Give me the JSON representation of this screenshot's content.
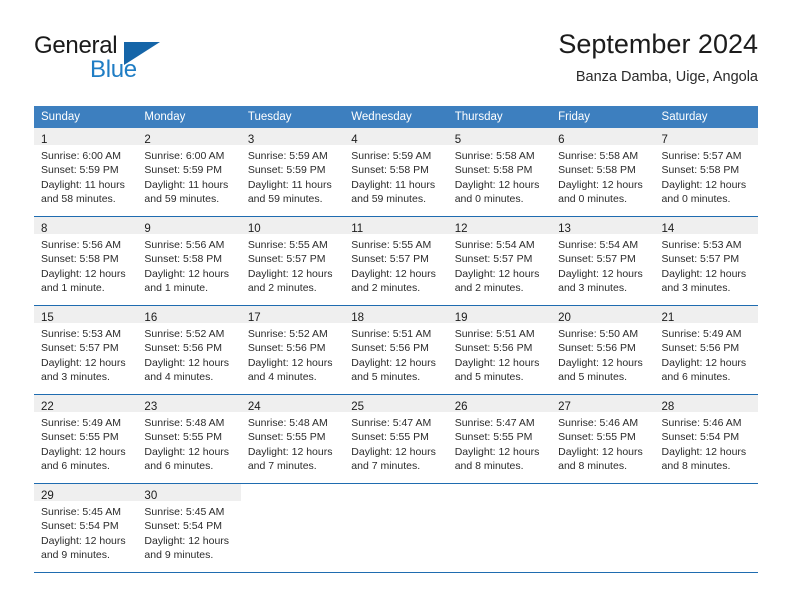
{
  "brand": {
    "name_part1": "General",
    "name_part2": "Blue",
    "triangle_icon": "logo-triangle"
  },
  "header": {
    "month_title": "September 2024",
    "location": "Banza Damba, Uige, Angola"
  },
  "weekday_headers": [
    "Sunday",
    "Monday",
    "Tuesday",
    "Wednesday",
    "Thursday",
    "Friday",
    "Saturday"
  ],
  "colors": {
    "header_blue": "#3d7fbf",
    "row_divider_blue": "#1f6cb0",
    "daynum_band": "#efefef",
    "brand_blue": "#1f7dc4",
    "triangle_blue": "#1565a8"
  },
  "weeks": [
    [
      {
        "day": "1",
        "sunrise": "Sunrise: 6:00 AM",
        "sunset": "Sunset: 5:59 PM",
        "daylight_line1": "Daylight: 11 hours",
        "daylight_line2": "and 58 minutes."
      },
      {
        "day": "2",
        "sunrise": "Sunrise: 6:00 AM",
        "sunset": "Sunset: 5:59 PM",
        "daylight_line1": "Daylight: 11 hours",
        "daylight_line2": "and 59 minutes."
      },
      {
        "day": "3",
        "sunrise": "Sunrise: 5:59 AM",
        "sunset": "Sunset: 5:59 PM",
        "daylight_line1": "Daylight: 11 hours",
        "daylight_line2": "and 59 minutes."
      },
      {
        "day": "4",
        "sunrise": "Sunrise: 5:59 AM",
        "sunset": "Sunset: 5:58 PM",
        "daylight_line1": "Daylight: 11 hours",
        "daylight_line2": "and 59 minutes."
      },
      {
        "day": "5",
        "sunrise": "Sunrise: 5:58 AM",
        "sunset": "Sunset: 5:58 PM",
        "daylight_line1": "Daylight: 12 hours",
        "daylight_line2": "and 0 minutes."
      },
      {
        "day": "6",
        "sunrise": "Sunrise: 5:58 AM",
        "sunset": "Sunset: 5:58 PM",
        "daylight_line1": "Daylight: 12 hours",
        "daylight_line2": "and 0 minutes."
      },
      {
        "day": "7",
        "sunrise": "Sunrise: 5:57 AM",
        "sunset": "Sunset: 5:58 PM",
        "daylight_line1": "Daylight: 12 hours",
        "daylight_line2": "and 0 minutes."
      }
    ],
    [
      {
        "day": "8",
        "sunrise": "Sunrise: 5:56 AM",
        "sunset": "Sunset: 5:58 PM",
        "daylight_line1": "Daylight: 12 hours",
        "daylight_line2": "and 1 minute."
      },
      {
        "day": "9",
        "sunrise": "Sunrise: 5:56 AM",
        "sunset": "Sunset: 5:58 PM",
        "daylight_line1": "Daylight: 12 hours",
        "daylight_line2": "and 1 minute."
      },
      {
        "day": "10",
        "sunrise": "Sunrise: 5:55 AM",
        "sunset": "Sunset: 5:57 PM",
        "daylight_line1": "Daylight: 12 hours",
        "daylight_line2": "and 2 minutes."
      },
      {
        "day": "11",
        "sunrise": "Sunrise: 5:55 AM",
        "sunset": "Sunset: 5:57 PM",
        "daylight_line1": "Daylight: 12 hours",
        "daylight_line2": "and 2 minutes."
      },
      {
        "day": "12",
        "sunrise": "Sunrise: 5:54 AM",
        "sunset": "Sunset: 5:57 PM",
        "daylight_line1": "Daylight: 12 hours",
        "daylight_line2": "and 2 minutes."
      },
      {
        "day": "13",
        "sunrise": "Sunrise: 5:54 AM",
        "sunset": "Sunset: 5:57 PM",
        "daylight_line1": "Daylight: 12 hours",
        "daylight_line2": "and 3 minutes."
      },
      {
        "day": "14",
        "sunrise": "Sunrise: 5:53 AM",
        "sunset": "Sunset: 5:57 PM",
        "daylight_line1": "Daylight: 12 hours",
        "daylight_line2": "and 3 minutes."
      }
    ],
    [
      {
        "day": "15",
        "sunrise": "Sunrise: 5:53 AM",
        "sunset": "Sunset: 5:57 PM",
        "daylight_line1": "Daylight: 12 hours",
        "daylight_line2": "and 3 minutes."
      },
      {
        "day": "16",
        "sunrise": "Sunrise: 5:52 AM",
        "sunset": "Sunset: 5:56 PM",
        "daylight_line1": "Daylight: 12 hours",
        "daylight_line2": "and 4 minutes."
      },
      {
        "day": "17",
        "sunrise": "Sunrise: 5:52 AM",
        "sunset": "Sunset: 5:56 PM",
        "daylight_line1": "Daylight: 12 hours",
        "daylight_line2": "and 4 minutes."
      },
      {
        "day": "18",
        "sunrise": "Sunrise: 5:51 AM",
        "sunset": "Sunset: 5:56 PM",
        "daylight_line1": "Daylight: 12 hours",
        "daylight_line2": "and 5 minutes."
      },
      {
        "day": "19",
        "sunrise": "Sunrise: 5:51 AM",
        "sunset": "Sunset: 5:56 PM",
        "daylight_line1": "Daylight: 12 hours",
        "daylight_line2": "and 5 minutes."
      },
      {
        "day": "20",
        "sunrise": "Sunrise: 5:50 AM",
        "sunset": "Sunset: 5:56 PM",
        "daylight_line1": "Daylight: 12 hours",
        "daylight_line2": "and 5 minutes."
      },
      {
        "day": "21",
        "sunrise": "Sunrise: 5:49 AM",
        "sunset": "Sunset: 5:56 PM",
        "daylight_line1": "Daylight: 12 hours",
        "daylight_line2": "and 6 minutes."
      }
    ],
    [
      {
        "day": "22",
        "sunrise": "Sunrise: 5:49 AM",
        "sunset": "Sunset: 5:55 PM",
        "daylight_line1": "Daylight: 12 hours",
        "daylight_line2": "and 6 minutes."
      },
      {
        "day": "23",
        "sunrise": "Sunrise: 5:48 AM",
        "sunset": "Sunset: 5:55 PM",
        "daylight_line1": "Daylight: 12 hours",
        "daylight_line2": "and 6 minutes."
      },
      {
        "day": "24",
        "sunrise": "Sunrise: 5:48 AM",
        "sunset": "Sunset: 5:55 PM",
        "daylight_line1": "Daylight: 12 hours",
        "daylight_line2": "and 7 minutes."
      },
      {
        "day": "25",
        "sunrise": "Sunrise: 5:47 AM",
        "sunset": "Sunset: 5:55 PM",
        "daylight_line1": "Daylight: 12 hours",
        "daylight_line2": "and 7 minutes."
      },
      {
        "day": "26",
        "sunrise": "Sunrise: 5:47 AM",
        "sunset": "Sunset: 5:55 PM",
        "daylight_line1": "Daylight: 12 hours",
        "daylight_line2": "and 8 minutes."
      },
      {
        "day": "27",
        "sunrise": "Sunrise: 5:46 AM",
        "sunset": "Sunset: 5:55 PM",
        "daylight_line1": "Daylight: 12 hours",
        "daylight_line2": "and 8 minutes."
      },
      {
        "day": "28",
        "sunrise": "Sunrise: 5:46 AM",
        "sunset": "Sunset: 5:54 PM",
        "daylight_line1": "Daylight: 12 hours",
        "daylight_line2": "and 8 minutes."
      }
    ],
    [
      {
        "day": "29",
        "sunrise": "Sunrise: 5:45 AM",
        "sunset": "Sunset: 5:54 PM",
        "daylight_line1": "Daylight: 12 hours",
        "daylight_line2": "and 9 minutes."
      },
      {
        "day": "30",
        "sunrise": "Sunrise: 5:45 AM",
        "sunset": "Sunset: 5:54 PM",
        "daylight_line1": "Daylight: 12 hours",
        "daylight_line2": "and 9 minutes."
      },
      {
        "day": "",
        "sunrise": "",
        "sunset": "",
        "daylight_line1": "",
        "daylight_line2": ""
      },
      {
        "day": "",
        "sunrise": "",
        "sunset": "",
        "daylight_line1": "",
        "daylight_line2": ""
      },
      {
        "day": "",
        "sunrise": "",
        "sunset": "",
        "daylight_line1": "",
        "daylight_line2": ""
      },
      {
        "day": "",
        "sunrise": "",
        "sunset": "",
        "daylight_line1": "",
        "daylight_line2": ""
      },
      {
        "day": "",
        "sunrise": "",
        "sunset": "",
        "daylight_line1": "",
        "daylight_line2": ""
      }
    ]
  ]
}
